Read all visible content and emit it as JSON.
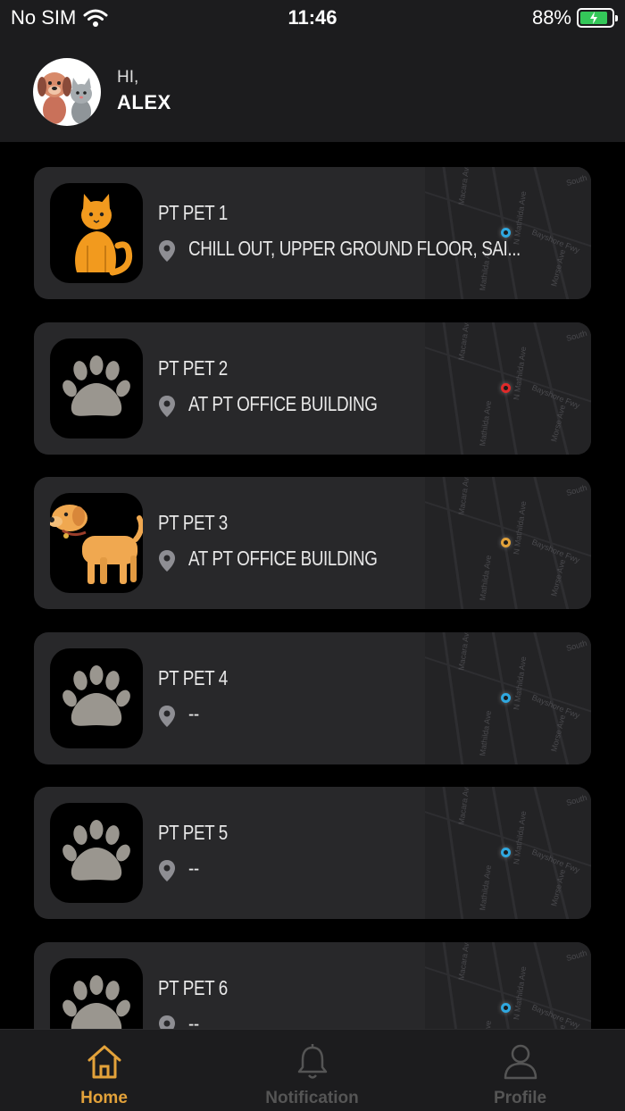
{
  "status_bar": {
    "carrier": "No SIM",
    "time": "11:46",
    "battery": "88%",
    "battery_level": 0.88
  },
  "header": {
    "greeting": "HI,",
    "user_name": "ALEX"
  },
  "pets": [
    {
      "name": "PT PET 1",
      "location": "CHILL OUT, UPPER GROUND FLOOR, SAI...",
      "photo": "cat-illustration",
      "marker_color": "#2fa8e0"
    },
    {
      "name": "PT PET 2",
      "location": "AT PT OFFICE BUILDING",
      "photo": "paw-icon",
      "marker_color": "#e02a2a"
    },
    {
      "name": "PT PET 3",
      "location": "AT PT OFFICE BUILDING",
      "photo": "dog-illustration",
      "marker_color": "#e3a23a"
    },
    {
      "name": "PT PET 4",
      "location": "--",
      "photo": "paw-icon",
      "marker_color": "#2fa8e0"
    },
    {
      "name": "PT PET 5",
      "location": "--",
      "photo": "paw-icon",
      "marker_color": "#2fa8e0"
    },
    {
      "name": "PT PET 6",
      "location": "--",
      "photo": "paw-icon",
      "marker_color": "#2fa8e0"
    }
  ],
  "map_labels": {
    "south": "South",
    "bayshore": "Bayshore Fwy",
    "road_a": "N Mathilda Ave",
    "road_b": "Macara Ave",
    "road_c": "Morse Ave",
    "road_d": "Mathilda Ave"
  },
  "tab_bar": {
    "tabs": [
      {
        "label": "Home",
        "icon": "home-icon",
        "active": true
      },
      {
        "label": "Notification",
        "icon": "bell-icon",
        "active": false
      },
      {
        "label": "Profile",
        "icon": "person-icon",
        "active": false
      }
    ]
  },
  "colors": {
    "accent": "#e3a23a",
    "card_bg": "#28282a",
    "bar_bg": "#1c1c1e",
    "battery_fill": "#34c759"
  }
}
